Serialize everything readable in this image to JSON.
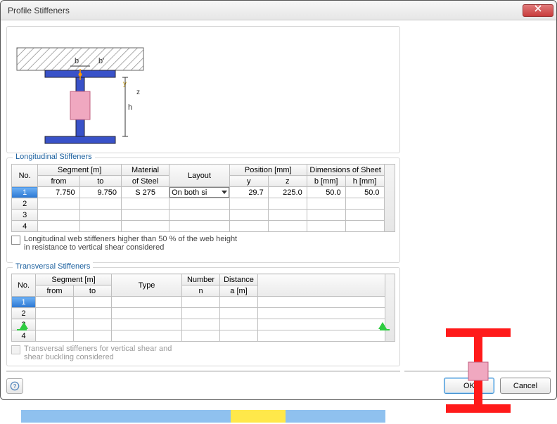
{
  "window": {
    "title": "Profile Stiffeners"
  },
  "longitudinal": {
    "legend": "Longitudinal Stiffeners",
    "headers": {
      "no": "No.",
      "segment": "Segment [m]",
      "from": "from",
      "to": "to",
      "material": "Material\nof Steel",
      "material_l1": "Material",
      "material_l2": "of Steel",
      "layout": "Layout",
      "position": "Position [mm]",
      "y": "y",
      "z": "z",
      "dim": "Dimensions of Sheet",
      "b": "b [mm]",
      "h": "h [mm]"
    },
    "rows": [
      {
        "no": "1",
        "from": "7.750",
        "to": "9.750",
        "material": "S 275",
        "layout": "On both si",
        "y": "29.7",
        "z": "225.0",
        "b": "50.0",
        "h": "50.0"
      },
      {
        "no": "2"
      },
      {
        "no": "3"
      },
      {
        "no": "4"
      }
    ],
    "checkbox_label_l1": "Longitudinal web stiffeners higher than 50 % of the web height",
    "checkbox_label_l2": "in resistance to vertical shear considered"
  },
  "transversal": {
    "legend": "Transversal Stiffeners",
    "headers": {
      "no": "No.",
      "segment": "Segment [m]",
      "from": "from",
      "to": "to",
      "type": "Type",
      "number_l1": "Number",
      "number_l2": "n",
      "distance_l1": "Distance",
      "distance_l2": "a [m]"
    },
    "rows": [
      {
        "no": "1"
      },
      {
        "no": "2"
      },
      {
        "no": "3"
      },
      {
        "no": "4"
      }
    ],
    "checkbox_label_l1": "Transversal stiffeners for vertical shear and",
    "checkbox_label_l2": "shear buckling considered"
  },
  "diagram_labels": {
    "b": "b",
    "bprime": "b'",
    "h": "h",
    "y": "y",
    "z": "z"
  },
  "buttons": {
    "ok": "OK",
    "cancel": "Cancel"
  },
  "colors": {
    "accent": "#1a5f9e",
    "beam": "#8fc1ef",
    "segment": "#ffe84a",
    "support": "#2ecc40",
    "section": "#ff1a1a"
  }
}
